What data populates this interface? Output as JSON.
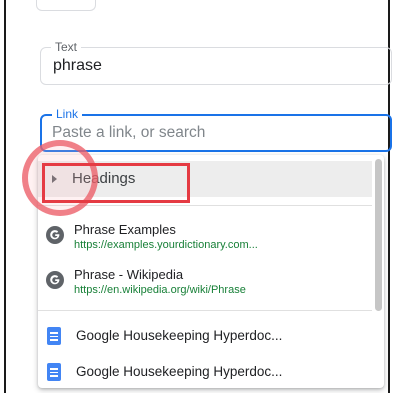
{
  "text_field": {
    "label": "Text",
    "value": "phrase"
  },
  "link_field": {
    "label": "Link",
    "placeholder": "Paste a link, or search",
    "value": ""
  },
  "dropdown": {
    "headings_label": "Headings",
    "web_results": [
      {
        "title": "Phrase Examples",
        "url": "https://examples.yourdictionary.com..."
      },
      {
        "title": "Phrase - Wikipedia",
        "url": "https://en.wikipedia.org/wiki/Phrase"
      }
    ],
    "doc_results": [
      {
        "title": "Google Housekeeping Hyperdoc..."
      },
      {
        "title": "Google Housekeeping Hyperdoc..."
      }
    ]
  },
  "colors": {
    "accent": "#1a73e8",
    "url_green": "#188038",
    "highlight_red": "#e53b43",
    "doc_blue": "#4285f4"
  },
  "icons": {
    "web_result": "google-g-icon",
    "doc_result": "google-docs-icon",
    "expand": "triangle-right-icon"
  }
}
